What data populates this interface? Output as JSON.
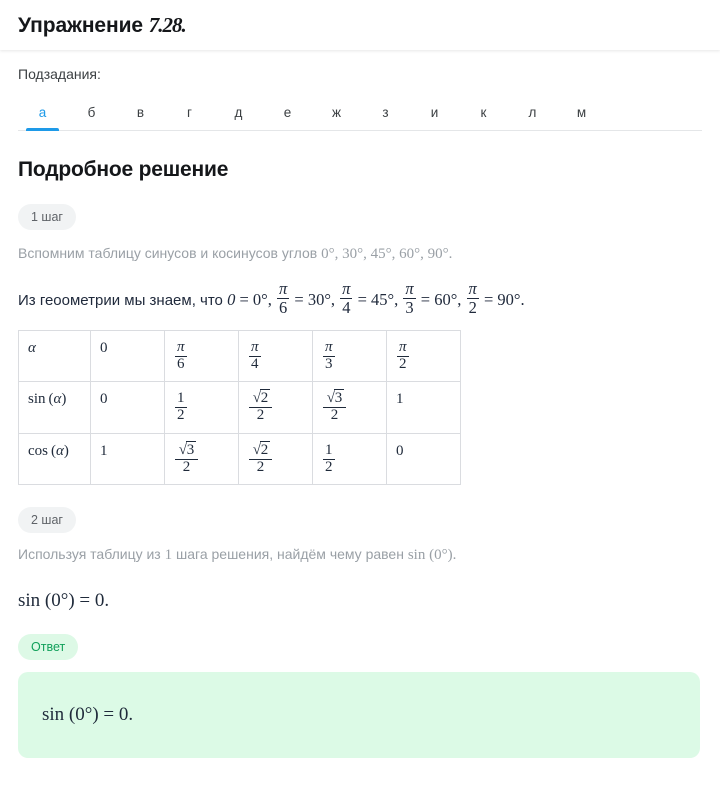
{
  "header": {
    "title_text": "Упражнение ",
    "title_number": "7.28."
  },
  "subtasks": {
    "label": "Подзадания:",
    "tabs": [
      {
        "label": "а",
        "active": true
      },
      {
        "label": "б",
        "active": false
      },
      {
        "label": "в",
        "active": false
      },
      {
        "label": "г",
        "active": false
      },
      {
        "label": "д",
        "active": false
      },
      {
        "label": "е",
        "active": false
      },
      {
        "label": "ж",
        "active": false
      },
      {
        "label": "з",
        "active": false
      },
      {
        "label": "и",
        "active": false
      },
      {
        "label": "к",
        "active": false
      },
      {
        "label": "л",
        "active": false
      },
      {
        "label": "м",
        "active": false
      }
    ]
  },
  "solution": {
    "heading": "Подробное решение",
    "step1": {
      "badge": "1 шаг",
      "text_prefix": "Вспомним таблицу синусов и косинусов углов ",
      "text_math": "0°, 30°, 45°, 60°, 90°.",
      "known_prefix": "Из геоометрии мы знаем, что ",
      "known_items": [
        {
          "left": "0",
          "right": "0°"
        },
        {
          "left_num": "π",
          "left_den": "6",
          "right": "30°"
        },
        {
          "left_num": "π",
          "left_den": "4",
          "right": "45°"
        },
        {
          "left_num": "π",
          "left_den": "3",
          "right": "60°"
        },
        {
          "left_num": "π",
          "left_den": "2",
          "right": "90°"
        }
      ]
    },
    "step2": {
      "badge": "2 шаг",
      "text_prefix": "Используя таблицу из ",
      "text_one": "1",
      "text_mid": " шага решения, найдём чему равен ",
      "text_math": "sin (0°).",
      "equation": "sin (0°) = 0."
    }
  },
  "table": {
    "row_alpha_label": "α",
    "row_sin_label": "sin (α)",
    "row_cos_label": "cos (α)",
    "alpha": [
      "0",
      "π/6",
      "π/4",
      "π/3",
      "π/2"
    ],
    "sin": [
      "0",
      "1/2",
      "√2/2",
      "√3/2",
      "1"
    ],
    "cos": [
      "1",
      "√3/2",
      "√2/2",
      "1/2",
      "0"
    ]
  },
  "answer": {
    "badge": "Ответ",
    "equation": "sin (0°) = 0."
  },
  "colors": {
    "accent_blue": "#1e9ae8",
    "answer_green_bg": "#dcfae6",
    "answer_badge_bg": "#ddf9e6",
    "answer_badge_text": "#11a05a",
    "muted_text": "#9aa0a6",
    "table_border": "#dadce0"
  }
}
